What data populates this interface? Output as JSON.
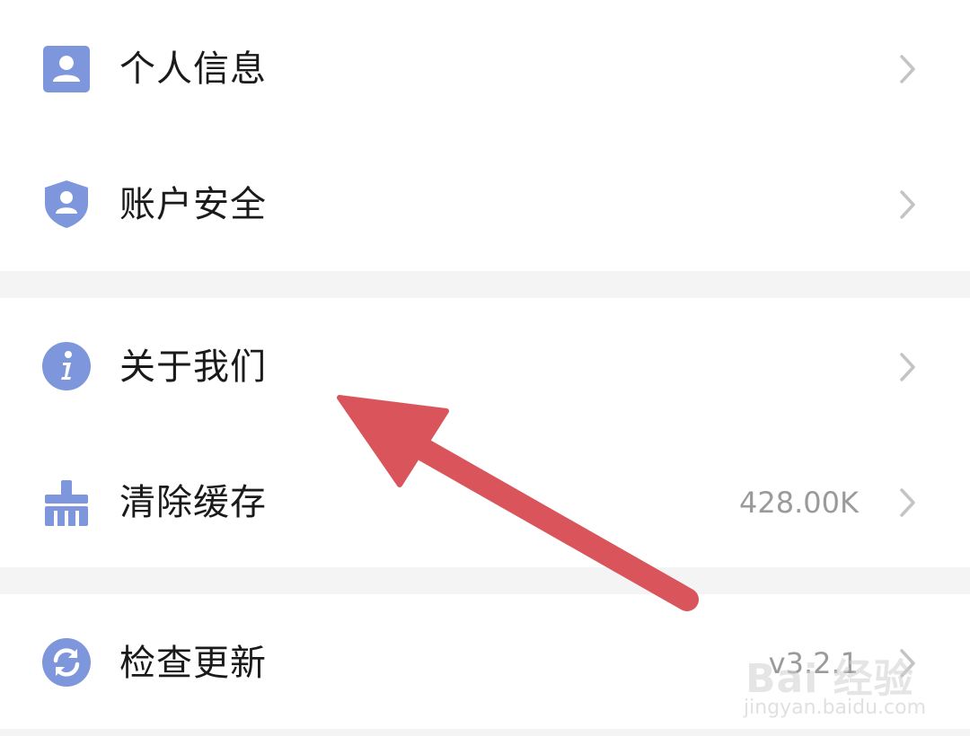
{
  "colors": {
    "icon_blue": "#7d96dc",
    "chevron": "#c4c4c4",
    "arrow": "#d9555b",
    "background": "#f4f4f5",
    "card": "#ffffff"
  },
  "settings": {
    "groups": [
      {
        "items": [
          {
            "label": "个人信息",
            "icon": "person-icon",
            "value": ""
          },
          {
            "label": "账户安全",
            "icon": "shield-user-icon",
            "value": ""
          }
        ]
      },
      {
        "items": [
          {
            "label": "关于我们",
            "icon": "info-icon",
            "value": ""
          },
          {
            "label": "清除缓存",
            "icon": "broom-icon",
            "value": "428.00K"
          }
        ]
      },
      {
        "items": [
          {
            "label": "检查更新",
            "icon": "refresh-icon",
            "value": "v3.2.1"
          }
        ]
      }
    ]
  },
  "watermark": {
    "brand": "Bai 经验",
    "url": "jingyan.baidu.com"
  }
}
